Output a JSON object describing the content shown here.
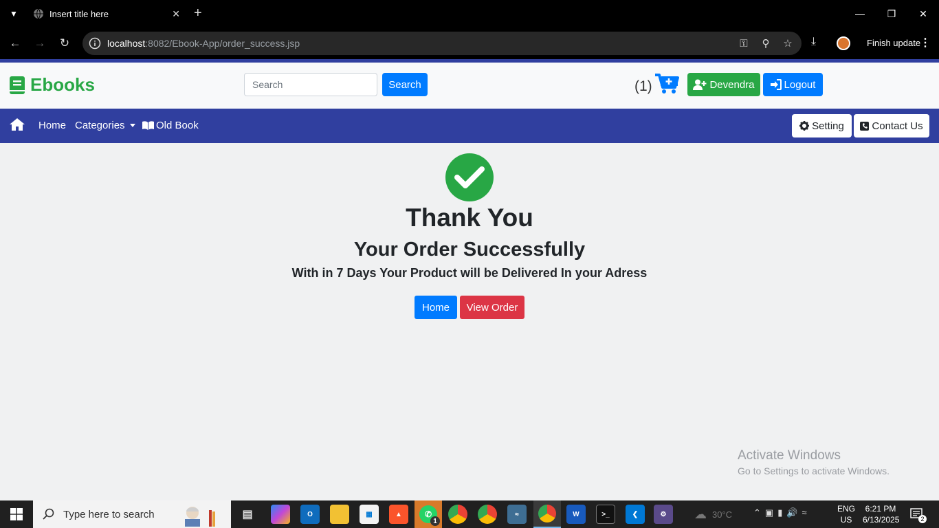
{
  "browser": {
    "tab_title": "Insert title here",
    "url_host": "localhost",
    "url_path": ":8082/Ebook-App/order_success.jsp",
    "update_label": "Finish update"
  },
  "header": {
    "brand": "Ebooks",
    "search_placeholder": "Search",
    "search_button": "Search",
    "cart_count": "(1)",
    "user_button": "Devendra",
    "logout_button": "Logout"
  },
  "navbar": {
    "home": "Home",
    "categories": "Categories",
    "old_book": "Old Book",
    "setting": "Setting",
    "contact": "Contact Us"
  },
  "main": {
    "heading": "Thank You",
    "subheading": "Your Order Successfully",
    "message": "With in 7 Days Your Product will be Delivered In your Adress",
    "home_button": "Home",
    "view_order_button": "View Order"
  },
  "watermark": {
    "line1": "Activate Windows",
    "line2": "Go to Settings to activate Windows."
  },
  "taskbar": {
    "search_placeholder": "Type here to search",
    "weather": "30°C",
    "lang_1": "ENG",
    "lang_2": "US",
    "time": "6:21 PM",
    "date": "6/13/2025",
    "notifications": "2",
    "whatsapp_badge": "1"
  },
  "colors": {
    "brand_green": "#28a745",
    "primary_blue": "#007bff",
    "navbar_indigo": "#303f9f",
    "danger_red": "#dc3545"
  }
}
